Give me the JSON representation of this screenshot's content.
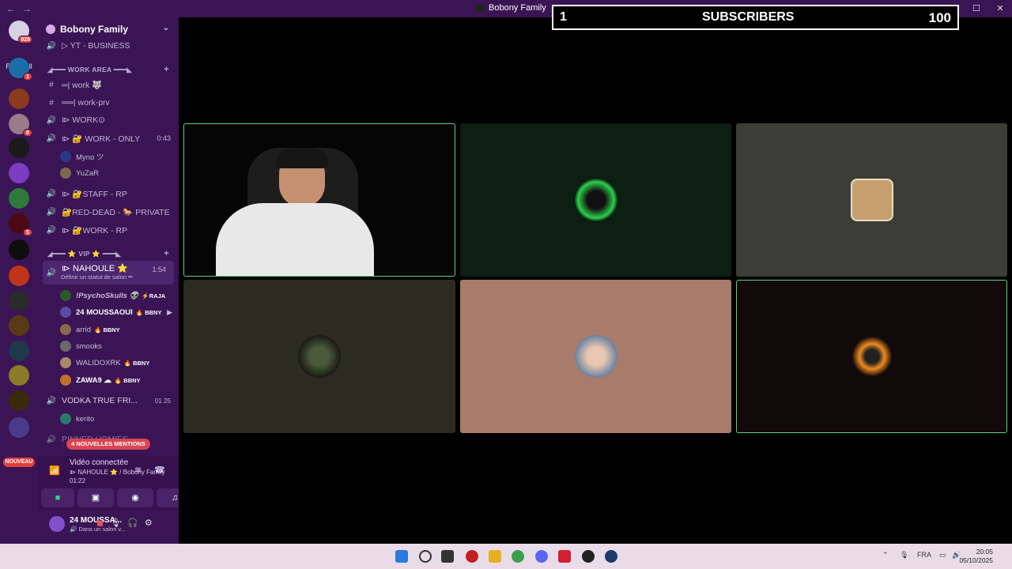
{
  "window": {
    "title": "Bobony Family",
    "back_icon": "←",
    "forward_icon": "→"
  },
  "server_rail": {
    "read_all": "Read All",
    "home_badge": "929",
    "nouveau": "NOUVEAU",
    "badges": [
      "1",
      "8",
      "5"
    ]
  },
  "guild": {
    "name": "Bobony Family"
  },
  "channels": {
    "yt_business": "▷ YT - BUSINESS",
    "work_area_category": "◢━━━ WORK AREA ━━━◣",
    "work": "═| work 🐺",
    "work_prv": "══| work-prv",
    "work_o": "⧐ WORK⊙",
    "work_only": "⧐ 🔐 WORK - ONLY",
    "work_only_timer": "0:43",
    "work_only_users": [
      {
        "name": "Myno ツ"
      },
      {
        "name": "YuZaR"
      }
    ],
    "staff_rp": "⧐ 🔐STAFF - RP",
    "red_dead": "🔐RED-DEAD - 🐎 PRIVATE",
    "work_rp": "⧐ 🔐WORK - RP",
    "vip_category": "◢━━━ ⭐ VIP ⭐ ━━━◣",
    "nahoule": "⧐ NAHOULE ⭐",
    "nahoule_status": "Définir un statut de salon ✏",
    "nahoule_timer": "1:54",
    "nahoule_users": [
      {
        "name": "!PsychoSkulls 👽",
        "tag": "⚡RAJA"
      },
      {
        "name": "24 MOUSSAOUI",
        "tag": "🔥 BBNY"
      },
      {
        "name": "arrid",
        "tag": "🔥 BBNY"
      },
      {
        "name": "smooks",
        "tag": ""
      },
      {
        "name": "WALIDOXRK",
        "tag": "🔥 BBNY"
      },
      {
        "name": "ZAWA9 ☁",
        "tag": "🔥 BBNY"
      }
    ],
    "vodka": "VODKA TRUE FRI...",
    "vodka_counts": "01 25",
    "vodka_users": [
      {
        "name": "kerito"
      }
    ],
    "pinned_partial": "PINNED HOMIES",
    "mentions": "4 NOUVELLES MENTIONS"
  },
  "voice_status": {
    "title": "Vidéo connectée",
    "channel": "⧐ NAHOULE ⭐ / Bobony Family",
    "elapsed": "01:22"
  },
  "user_panel": {
    "name": "24 MOUSSA...",
    "status": "🔊 Dans un salon v..."
  },
  "overlay": {
    "left": "1",
    "center": "SUBSCRIBERS",
    "right": "100"
  },
  "taskbar": {
    "lang": "FRA",
    "time": "20:05",
    "date": "05/10/2025"
  },
  "colors": {
    "accent": "#3a1454",
    "speaking": "#5bd27a",
    "danger": "#e43f3f"
  }
}
